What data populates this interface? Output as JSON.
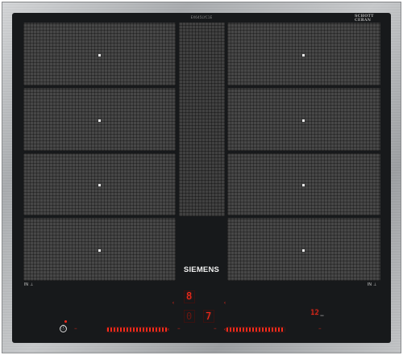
{
  "appliance": {
    "model_text": "EX645LYC1E",
    "glass_brand": [
      "SCHOTT",
      "CERAN",
      "EX645LYC1E"
    ],
    "brand": "SIEMENS"
  },
  "flex_zones": {
    "left_label": "IN",
    "right_label": "IN",
    "flex_symbol": "⊥",
    "left_zone_count": 4,
    "right_zone_count": 4
  },
  "controls": {
    "power_symbol": "ⓘ",
    "center_top_digit": "8",
    "center_left_digit": "0",
    "center_right_digit": "7",
    "timer_digits": "12",
    "timer_unit": "min",
    "slider_left": "left power slider",
    "slider_right": "right power slider",
    "chevron": "‹",
    "minus": "−"
  },
  "colors": {
    "glass": "#17191b",
    "zone": "#474747",
    "display_red": "#ff2a1a",
    "frame": "#b8babc"
  },
  "icons": [
    "power-icon",
    "flex-zone-icon",
    "minus-icon",
    "chevron-icon"
  ]
}
